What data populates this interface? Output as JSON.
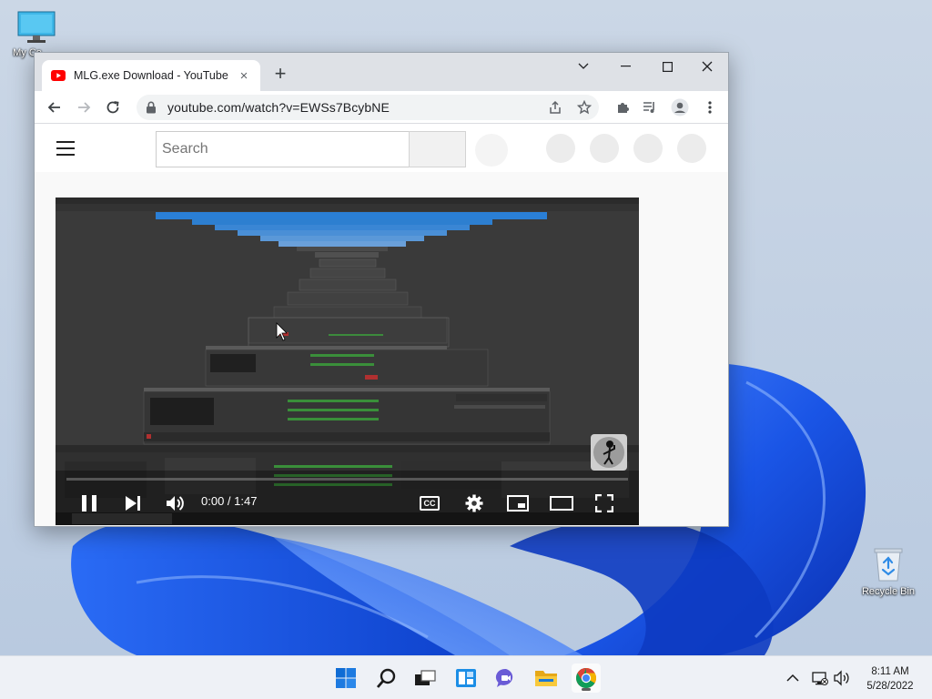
{
  "desktop": {
    "icons": [
      {
        "label": "My Co"
      },
      {
        "label": "Recycle Bin"
      }
    ]
  },
  "browser": {
    "tab": {
      "title": "MLG.exe Download - YouTube",
      "close_glyph": "×"
    },
    "new_tab_glyph": "+",
    "address": {
      "url": "youtube.com/watch?v=EWSs7BcybNE"
    }
  },
  "youtube": {
    "search": {
      "placeholder": "Search"
    },
    "player": {
      "time": "0:00 / 1:47",
      "cc_label": "CC",
      "progress": 0
    }
  },
  "taskbar": {
    "clock": {
      "time": "8:11 AM",
      "date": "5/28/2022"
    },
    "apps": [
      "start-icon",
      "search-icon",
      "task-view-icon",
      "widgets-icon",
      "chat-icon",
      "file-explorer-icon",
      "chrome-icon"
    ]
  },
  "colors": {
    "youtube_red": "#ff0000",
    "win_accent": "#0067c0",
    "bloom_blue": "#1f5fe0"
  }
}
